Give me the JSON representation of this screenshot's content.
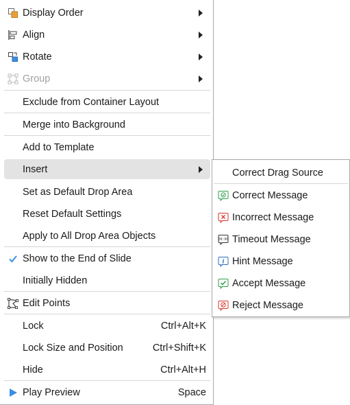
{
  "menu": {
    "items": [
      {
        "label": "Display Order",
        "icon": "display-order-icon",
        "submenu": true
      },
      {
        "label": "Align",
        "icon": "align-icon",
        "submenu": true
      },
      {
        "label": "Rotate",
        "icon": "rotate-icon",
        "submenu": true
      },
      {
        "label": "Group",
        "icon": "group-icon",
        "submenu": true,
        "disabled": true
      },
      {
        "label": "Exclude from Container Layout"
      },
      {
        "label": "Merge into Background"
      },
      {
        "label": "Add to Template"
      },
      {
        "label": "Insert",
        "submenu": true,
        "highlighted": true
      },
      {
        "label": "Set as Default Drop Area"
      },
      {
        "label": "Reset Default Settings"
      },
      {
        "label": "Apply to All Drop Area Objects"
      },
      {
        "label": "Show to the End of Slide",
        "icon": "checkmark-icon",
        "checked": true
      },
      {
        "label": "Initially Hidden"
      },
      {
        "label": "Edit Points",
        "icon": "edit-points-icon"
      },
      {
        "label": "Lock",
        "shortcut": "Ctrl+Alt+K"
      },
      {
        "label": "Lock Size and Position",
        "shortcut": "Ctrl+Shift+K"
      },
      {
        "label": "Hide",
        "shortcut": "Ctrl+Alt+H"
      },
      {
        "label": "Play Preview",
        "icon": "play-icon",
        "shortcut": "Space"
      }
    ]
  },
  "submenu": {
    "items": [
      {
        "label": "Correct Drag Source"
      },
      {
        "label": "Correct Message",
        "icon": "correct-message-icon"
      },
      {
        "label": "Incorrect Message",
        "icon": "incorrect-message-icon"
      },
      {
        "label": "Timeout Message",
        "icon": "timeout-message-icon"
      },
      {
        "label": "Hint Message",
        "icon": "hint-message-icon"
      },
      {
        "label": "Accept Message",
        "icon": "accept-message-icon"
      },
      {
        "label": "Reject Message",
        "icon": "reject-message-icon"
      }
    ]
  },
  "colors": {
    "highlight": "#e3e3e3",
    "accent_blue": "#3b8ee0",
    "green": "#2e9e4a",
    "red": "#d9342b",
    "orange": "#e8a23a"
  }
}
